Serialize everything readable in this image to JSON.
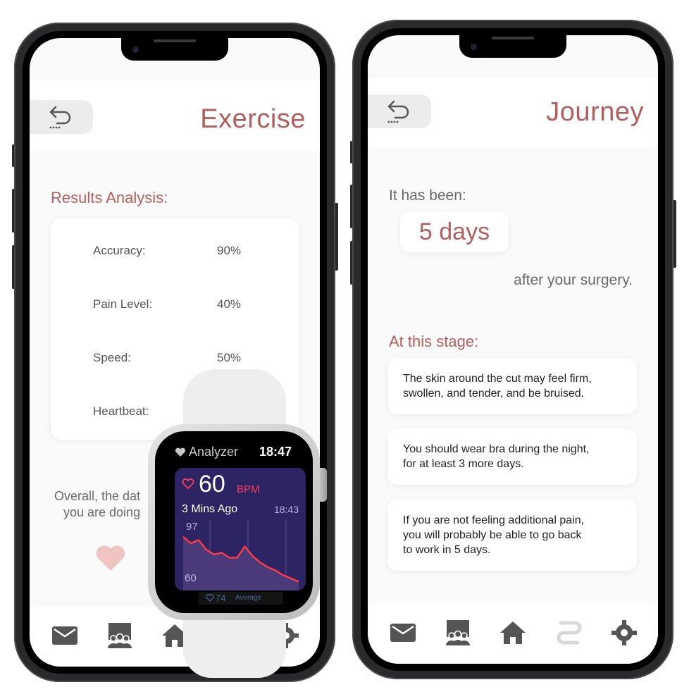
{
  "left_phone": {
    "header": {
      "title": "Exercise",
      "back_icon": "back-arrow-icon"
    },
    "results": {
      "heading": "Results Analysis:",
      "metrics": [
        {
          "label": "Accuracy:",
          "value": "90%"
        },
        {
          "label": "Pain Level:",
          "value": "40%"
        },
        {
          "label": "Speed:",
          "value": "50%"
        },
        {
          "label": "Heartbeat:",
          "value": ""
        }
      ]
    },
    "overall": {
      "line1": "Overall, the dat",
      "line2": "you are doing"
    },
    "heart_icon": "heart-icon",
    "nav": [
      "mail-icon",
      "community-icon",
      "home-icon",
      "settings-icon"
    ]
  },
  "watch": {
    "app_name": "Analyzer",
    "time": "18:47",
    "bpm_value": "60",
    "bpm_unit": "BPM",
    "last_reading": "3 Mins Ago",
    "last_time": "18:43",
    "y_max": "97",
    "y_min": "60",
    "average_value": "74",
    "average_label": "Average"
  },
  "right_phone": {
    "header": {
      "title": "Journey",
      "back_icon": "back-arrow-icon"
    },
    "intro": "It has been:",
    "days": "5 days",
    "after": "after your surgery.",
    "stage_heading": "At this stage:",
    "stages": [
      {
        "line1": "The skin around the cut may feel firm,",
        "line2": "swollen, and tender, and be bruised.",
        "line3": ""
      },
      {
        "line1": "You should wear bra during the night,",
        "line2": "for at least 3 more days.",
        "line3": ""
      },
      {
        "line1": "If you are not feeling additional pain,",
        "line2": "you will probably be able to go back",
        "line3": "to work in 5 days."
      }
    ],
    "nav": [
      "mail-icon",
      "community-icon",
      "home-icon",
      "journey-icon",
      "settings-icon"
    ]
  },
  "colors": {
    "accent": "#b35f5e",
    "heart": "#f0c4c1",
    "nav_icon": "#555555",
    "nav_active": "#d8d8d8",
    "watch_red": "#ff3b5c"
  },
  "chart_data": {
    "type": "line",
    "series": [
      {
        "values": [
          90,
          86,
          88,
          82,
          79,
          80,
          77,
          77,
          84,
          78,
          74,
          71,
          69,
          66,
          64,
          62
        ]
      }
    ],
    "ylim": [
      60,
      97
    ]
  }
}
